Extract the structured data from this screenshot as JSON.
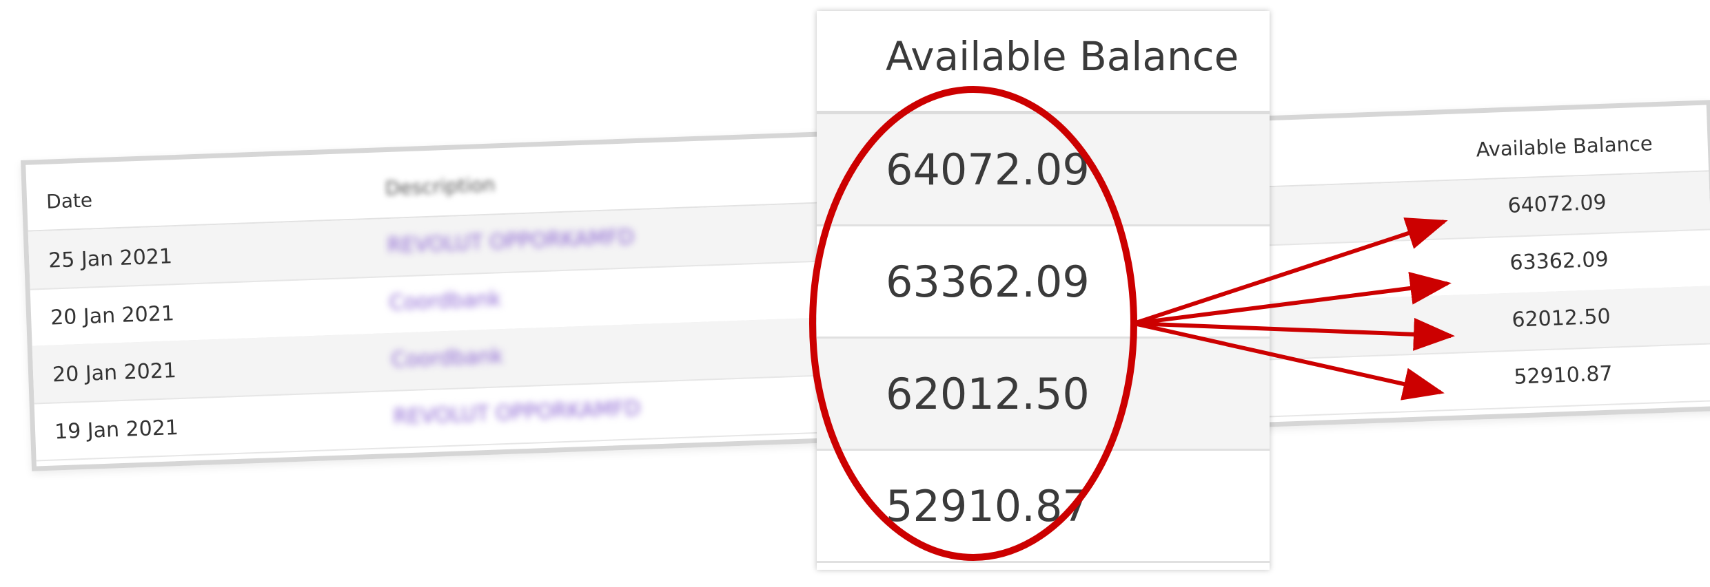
{
  "table": {
    "headers": {
      "date": "Date",
      "description": "Description",
      "available_balance": "Available Balance"
    },
    "rows": [
      {
        "date": "25 Jan 2021",
        "description": "REVOLUT OPPORKAMFD",
        "balance": "64072.09"
      },
      {
        "date": "20 Jan 2021",
        "description": "Coordbank",
        "balance": "63362.09"
      },
      {
        "date": "20 Jan 2021",
        "description": "Coordbank",
        "balance": "62012.50"
      },
      {
        "date": "19 Jan 2021",
        "description": "REVOLUT OPPORKAMFD",
        "balance": "52910.87"
      }
    ]
  },
  "zoom": {
    "header": "Available Balance",
    "values": [
      "64072.09",
      "63362.09",
      "62012.50",
      "52910.87"
    ]
  },
  "annotation": {
    "color": "#cc0000"
  }
}
